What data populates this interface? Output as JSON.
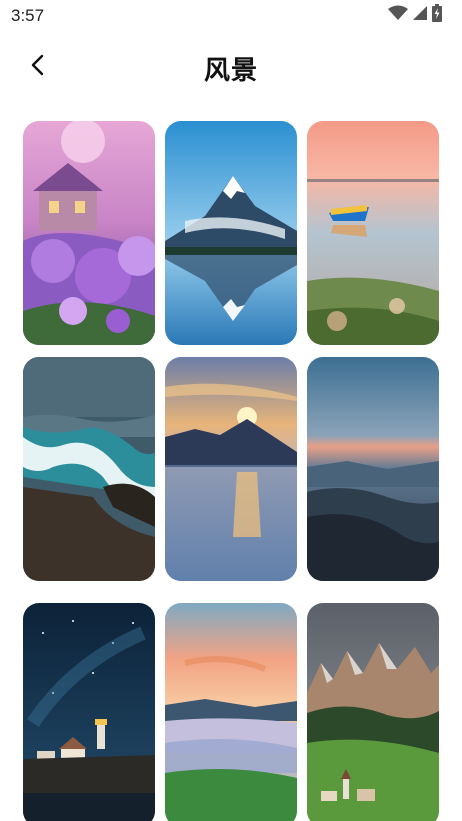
{
  "status_bar": {
    "time": "3:57",
    "icons": [
      "wifi-icon",
      "cell-signal-icon",
      "battery-charging-icon"
    ]
  },
  "header": {
    "title": "风景",
    "back_icon": "chevron-left-icon"
  },
  "wallpapers": [
    {
      "scene": "lavender-cottage"
    },
    {
      "scene": "snow-mountain-lake"
    },
    {
      "scene": "boat-sunset-lake"
    },
    {
      "scene": "ocean-waves-rocks"
    },
    {
      "scene": "mountain-sunset-lake"
    },
    {
      "scene": "misty-mountain-valley"
    },
    {
      "scene": "starry-night-lighthouse"
    },
    {
      "scene": "sunset-fog-meadow"
    },
    {
      "scene": "dolomites-village"
    }
  ]
}
